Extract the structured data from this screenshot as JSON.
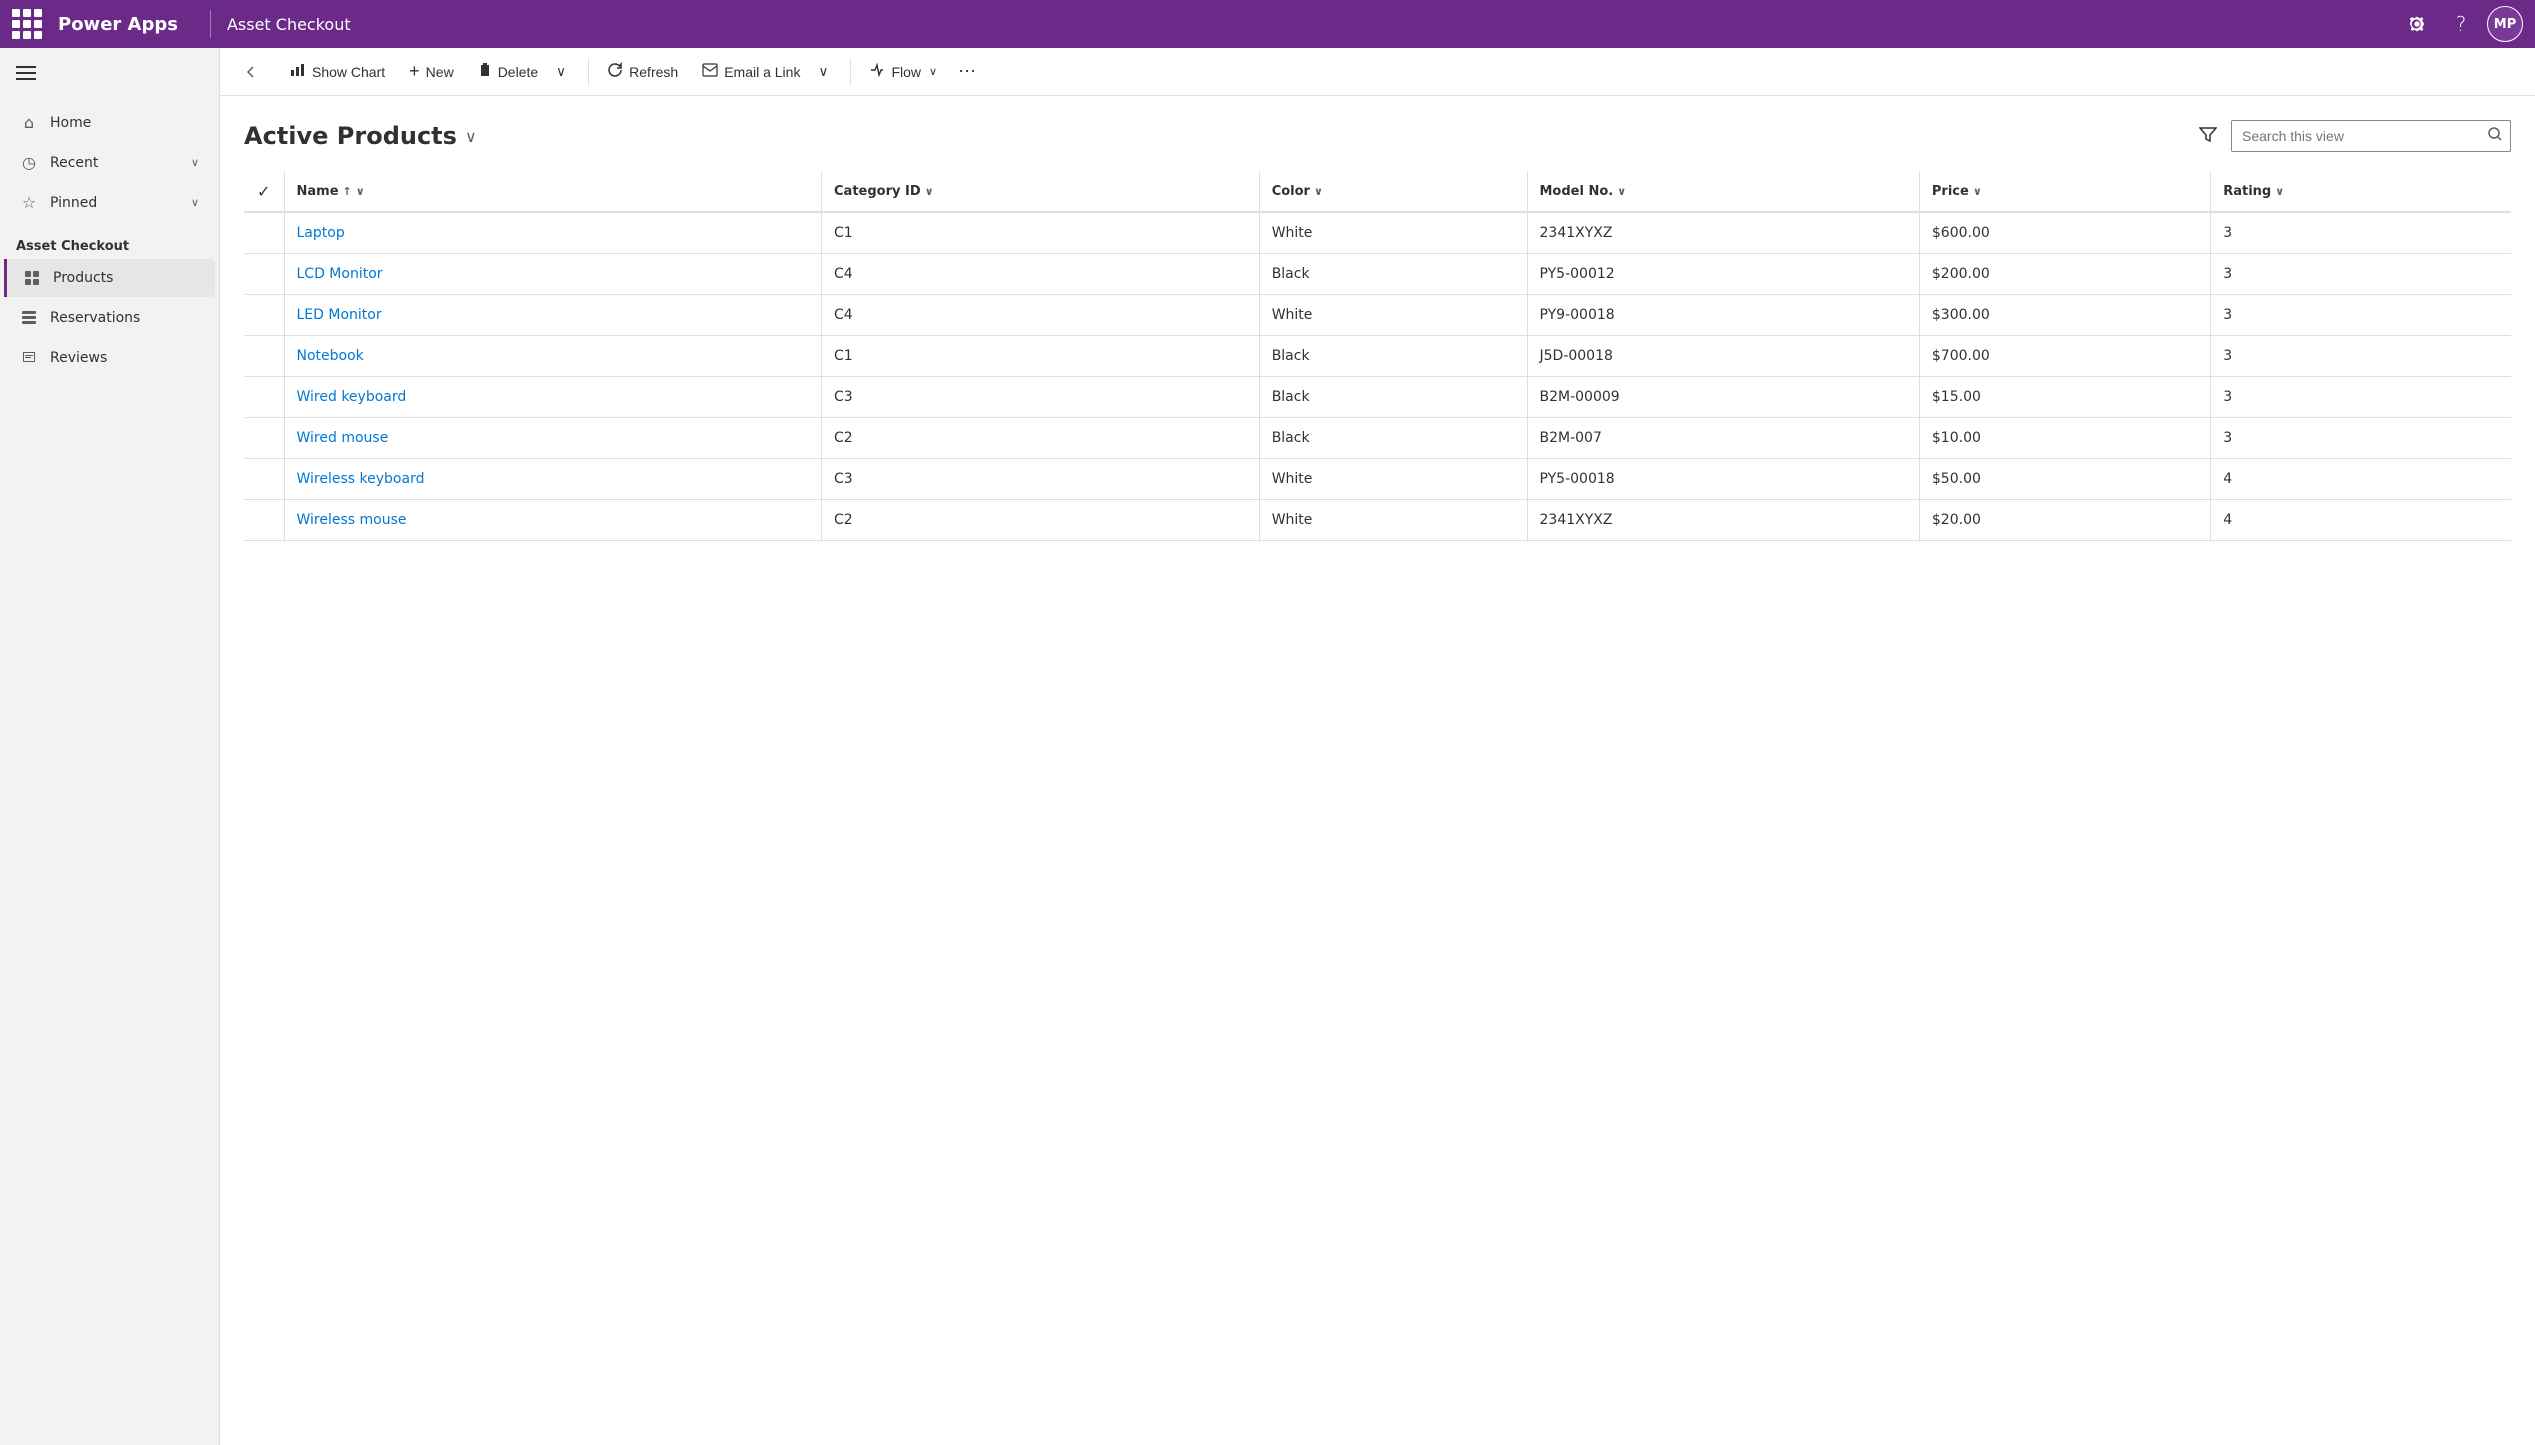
{
  "topbar": {
    "brand": "Power Apps",
    "appname": "Asset Checkout",
    "avatar_initials": "MP",
    "settings_label": "Settings",
    "help_label": "Help"
  },
  "sidebar": {
    "nav_items": [
      {
        "id": "home",
        "label": "Home",
        "icon": "⌂",
        "has_chevron": false
      },
      {
        "id": "recent",
        "label": "Recent",
        "icon": "◷",
        "has_chevron": true
      },
      {
        "id": "pinned",
        "label": "Pinned",
        "icon": "☆",
        "has_chevron": true
      }
    ],
    "section_title": "Asset Checkout",
    "app_items": [
      {
        "id": "products",
        "label": "Products",
        "icon": "📦",
        "active": true
      },
      {
        "id": "reservations",
        "label": "Reservations",
        "icon": "📋",
        "active": false
      },
      {
        "id": "reviews",
        "label": "Reviews",
        "icon": "📝",
        "active": false
      }
    ]
  },
  "commandbar": {
    "show_chart_label": "Show Chart",
    "new_label": "New",
    "delete_label": "Delete",
    "refresh_label": "Refresh",
    "email_link_label": "Email a Link",
    "flow_label": "Flow"
  },
  "view": {
    "title": "Active Products",
    "search_placeholder": "Search this view",
    "columns": [
      {
        "id": "name",
        "label": "Name",
        "sortable": true,
        "sort_dir": "asc"
      },
      {
        "id": "category_id",
        "label": "Category ID",
        "sortable": true
      },
      {
        "id": "color",
        "label": "Color",
        "sortable": true
      },
      {
        "id": "model_no",
        "label": "Model No.",
        "sortable": true
      },
      {
        "id": "price",
        "label": "Price",
        "sortable": true
      },
      {
        "id": "rating",
        "label": "Rating",
        "sortable": true
      }
    ],
    "rows": [
      {
        "name": "Laptop",
        "category_id": "C1",
        "color": "White",
        "model_no": "2341XYXZ",
        "price": "$600.00",
        "rating": "3"
      },
      {
        "name": "LCD Monitor",
        "category_id": "C4",
        "color": "Black",
        "model_no": "PY5-00012",
        "price": "$200.00",
        "rating": "3"
      },
      {
        "name": "LED Monitor",
        "category_id": "C4",
        "color": "White",
        "model_no": "PY9-00018",
        "price": "$300.00",
        "rating": "3"
      },
      {
        "name": "Notebook",
        "category_id": "C1",
        "color": "Black",
        "model_no": "J5D-00018",
        "price": "$700.00",
        "rating": "3"
      },
      {
        "name": "Wired keyboard",
        "category_id": "C3",
        "color": "Black",
        "model_no": "B2M-00009",
        "price": "$15.00",
        "rating": "3"
      },
      {
        "name": "Wired mouse",
        "category_id": "C2",
        "color": "Black",
        "model_no": "B2M-007",
        "price": "$10.00",
        "rating": "3"
      },
      {
        "name": "Wireless keyboard",
        "category_id": "C3",
        "color": "White",
        "model_no": "PY5-00018",
        "price": "$50.00",
        "rating": "4"
      },
      {
        "name": "Wireless mouse",
        "category_id": "C2",
        "color": "White",
        "model_no": "2341XYXZ",
        "price": "$20.00",
        "rating": "4"
      }
    ]
  }
}
